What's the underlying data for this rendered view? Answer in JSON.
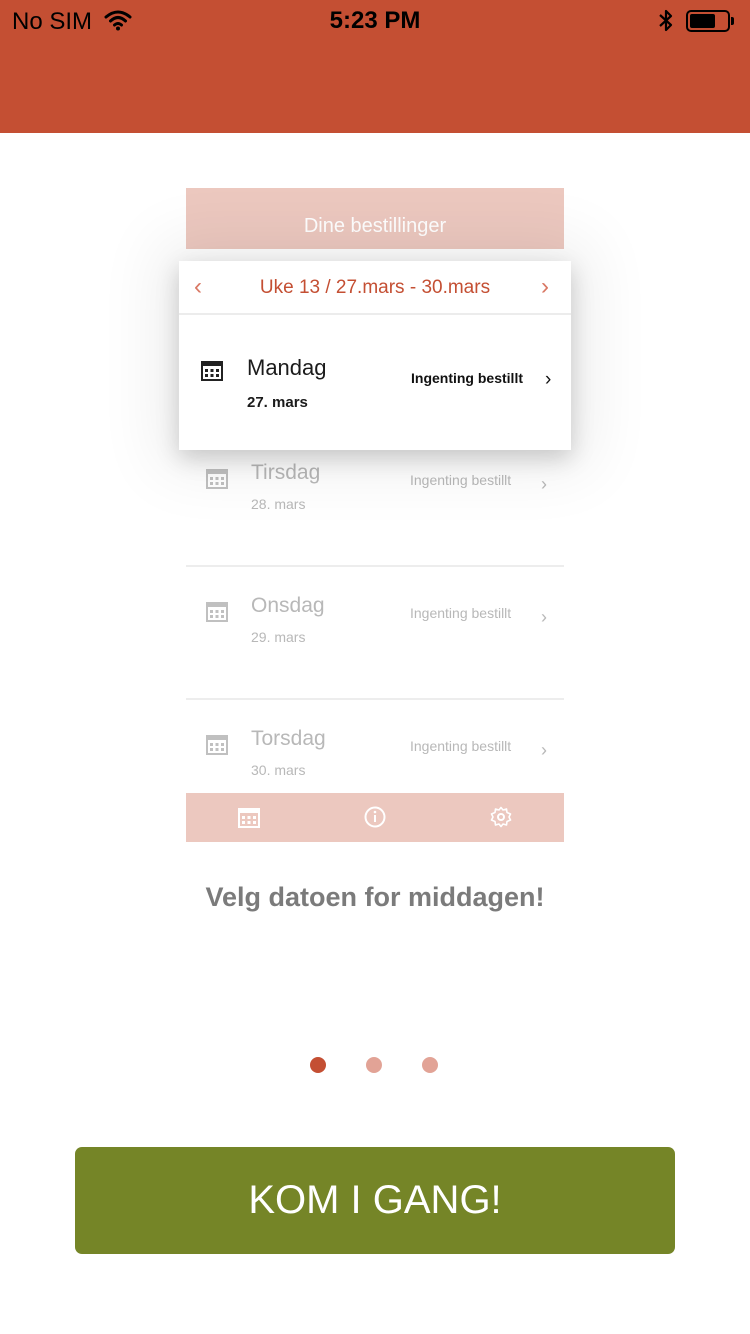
{
  "status_bar": {
    "carrier": "No SIM",
    "time": "5:23 PM",
    "battery_level": 0.7,
    "icons": [
      "wifi-icon",
      "bluetooth-icon",
      "battery-icon"
    ]
  },
  "colors": {
    "brand": "#c44f33",
    "cta": "#758527",
    "caption": "#7b7b7b",
    "dot_active": "#c44f33",
    "dot_inactive": "#e2a396"
  },
  "illustration": {
    "header_title": "Dine bestillinger",
    "week_label": "Uke 13 / 27.mars - 30.mars",
    "highlighted_day": {
      "day": "Mandag",
      "date": "27. mars",
      "status": "Ingenting bestillt"
    },
    "faded_days": [
      {
        "day": "Tirsdag",
        "date": "28. mars",
        "status": "Ingenting bestillt"
      },
      {
        "day": "Onsdag",
        "date": "29. mars",
        "status": "Ingenting bestillt"
      },
      {
        "day": "Torsdag",
        "date": "30. mars",
        "status": "Ingenting bestillt"
      }
    ],
    "tab_icons": [
      "calendar-icon",
      "info-icon",
      "settings-icon"
    ]
  },
  "caption": "Velg datoen for middagen!",
  "pager": {
    "count": 3,
    "active_index": 0
  },
  "cta_label": "KOM I GANG!"
}
